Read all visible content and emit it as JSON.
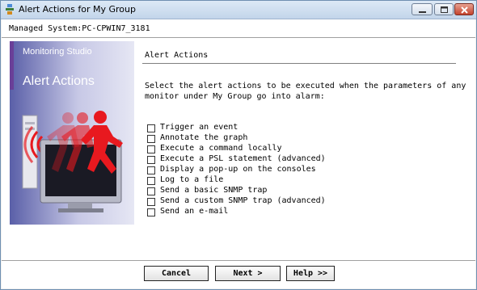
{
  "window": {
    "title": "Alert Actions for My Group"
  },
  "header": {
    "managed_system": "Managed System:PC-CPWIN7_3181"
  },
  "banner": {
    "subtitle": "Monitoring Studio",
    "title": "Alert Actions"
  },
  "main": {
    "section_title": "Alert Actions",
    "instructions": "Select the alert actions to be executed when the parameters of any monitor under My Group go into alarm:",
    "actions": [
      {
        "label": "Trigger an event",
        "checked": false
      },
      {
        "label": "Annotate the graph",
        "checked": false
      },
      {
        "label": "Execute a command locally",
        "checked": false
      },
      {
        "label": "Execute a PSL statement (advanced)",
        "checked": false
      },
      {
        "label": "Display a pop-up on the consoles",
        "checked": false
      },
      {
        "label": "Log to a file",
        "checked": false
      },
      {
        "label": "Send a basic SNMP trap",
        "checked": false
      },
      {
        "label": "Send a custom SNMP trap (advanced)",
        "checked": false
      },
      {
        "label": "Send an e-mail",
        "checked": false
      }
    ]
  },
  "buttons": {
    "cancel": "Cancel",
    "next": "Next >",
    "help": "Help >>"
  },
  "colors": {
    "accent": "#6a3f98",
    "figure": "#e8191f"
  }
}
